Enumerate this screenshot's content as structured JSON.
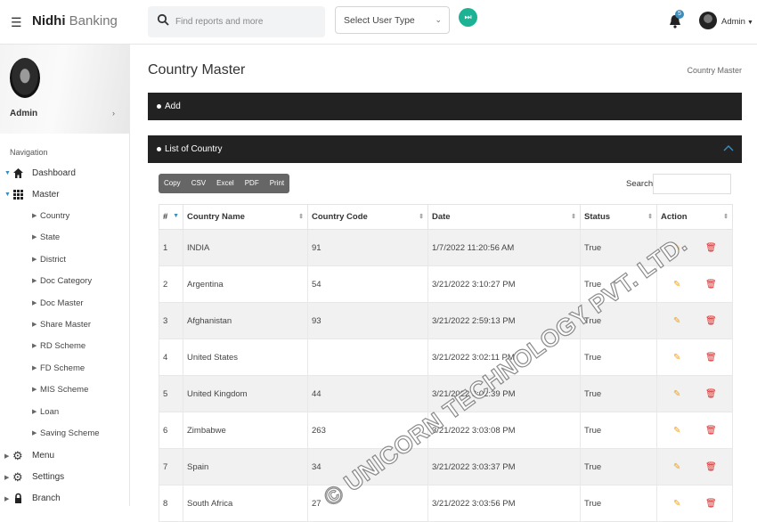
{
  "app": {
    "brand_bold": "Nidhi",
    "brand_rest": " Banking"
  },
  "header": {
    "search_placeholder": "Find reports and more",
    "user_type_select": "Select User Type",
    "notification_count": "5",
    "user_name": "Admin"
  },
  "sidebar": {
    "profile_name": "Admin",
    "nav_heading": "Navigation",
    "items": [
      {
        "label": "Dashboard",
        "icon": "home-icon"
      },
      {
        "label": "Master",
        "icon": "grid-icon"
      }
    ],
    "sub_items": [
      "Country",
      "State",
      "District",
      "Doc Category",
      "Doc Master",
      "Share Master",
      "RD Scheme",
      "FD Scheme",
      "MIS Scheme",
      "Loan",
      "Saving Scheme"
    ],
    "bottom_items": [
      {
        "label": "Menu",
        "icon": "gear-icon"
      },
      {
        "label": "Settings",
        "icon": "gear-icon"
      },
      {
        "label": "Branch",
        "icon": "lock-icon"
      }
    ]
  },
  "page": {
    "title": "Country Master",
    "breadcrumb": "Country Master",
    "add_bar_label": "Add",
    "list_bar_label": "List of Country"
  },
  "table": {
    "export_buttons": [
      "Copy",
      "CSV",
      "Excel",
      "PDF",
      "Print"
    ],
    "search_label": "Search:",
    "columns": [
      "#",
      "Country Name",
      "Country Code",
      "Date",
      "Status",
      "Action"
    ],
    "rows": [
      [
        "1",
        "INDIA",
        "91",
        "1/7/2022 11:20:56 AM",
        "True"
      ],
      [
        "2",
        "Argentina",
        "54",
        "3/21/2022 3:10:27 PM",
        "True"
      ],
      [
        "3",
        "Afghanistan",
        "93",
        "3/21/2022 2:59:13 PM",
        "True"
      ],
      [
        "4",
        "United States",
        "",
        "3/21/2022 3:02:11 PM",
        "True"
      ],
      [
        "5",
        "United Kingdom",
        "44",
        "3/21/2022 3:02:39 PM",
        "True"
      ],
      [
        "6",
        "Zimbabwe",
        "263",
        "3/21/2022 3:03:08 PM",
        "True"
      ],
      [
        "7",
        "Spain",
        "34",
        "3/21/2022 3:03:37 PM",
        "True"
      ],
      [
        "8",
        "South Africa",
        "27",
        "3/21/2022 3:03:56 PM",
        "True"
      ]
    ]
  },
  "watermark": "© UNICORN TECHNOLOGY PVT. LTD.",
  "colors": {
    "accent": "#3c8dbc",
    "teal": "#1bb394",
    "edit": "#f0a020",
    "delete": "#dd2a2a",
    "bar": "#222222"
  }
}
